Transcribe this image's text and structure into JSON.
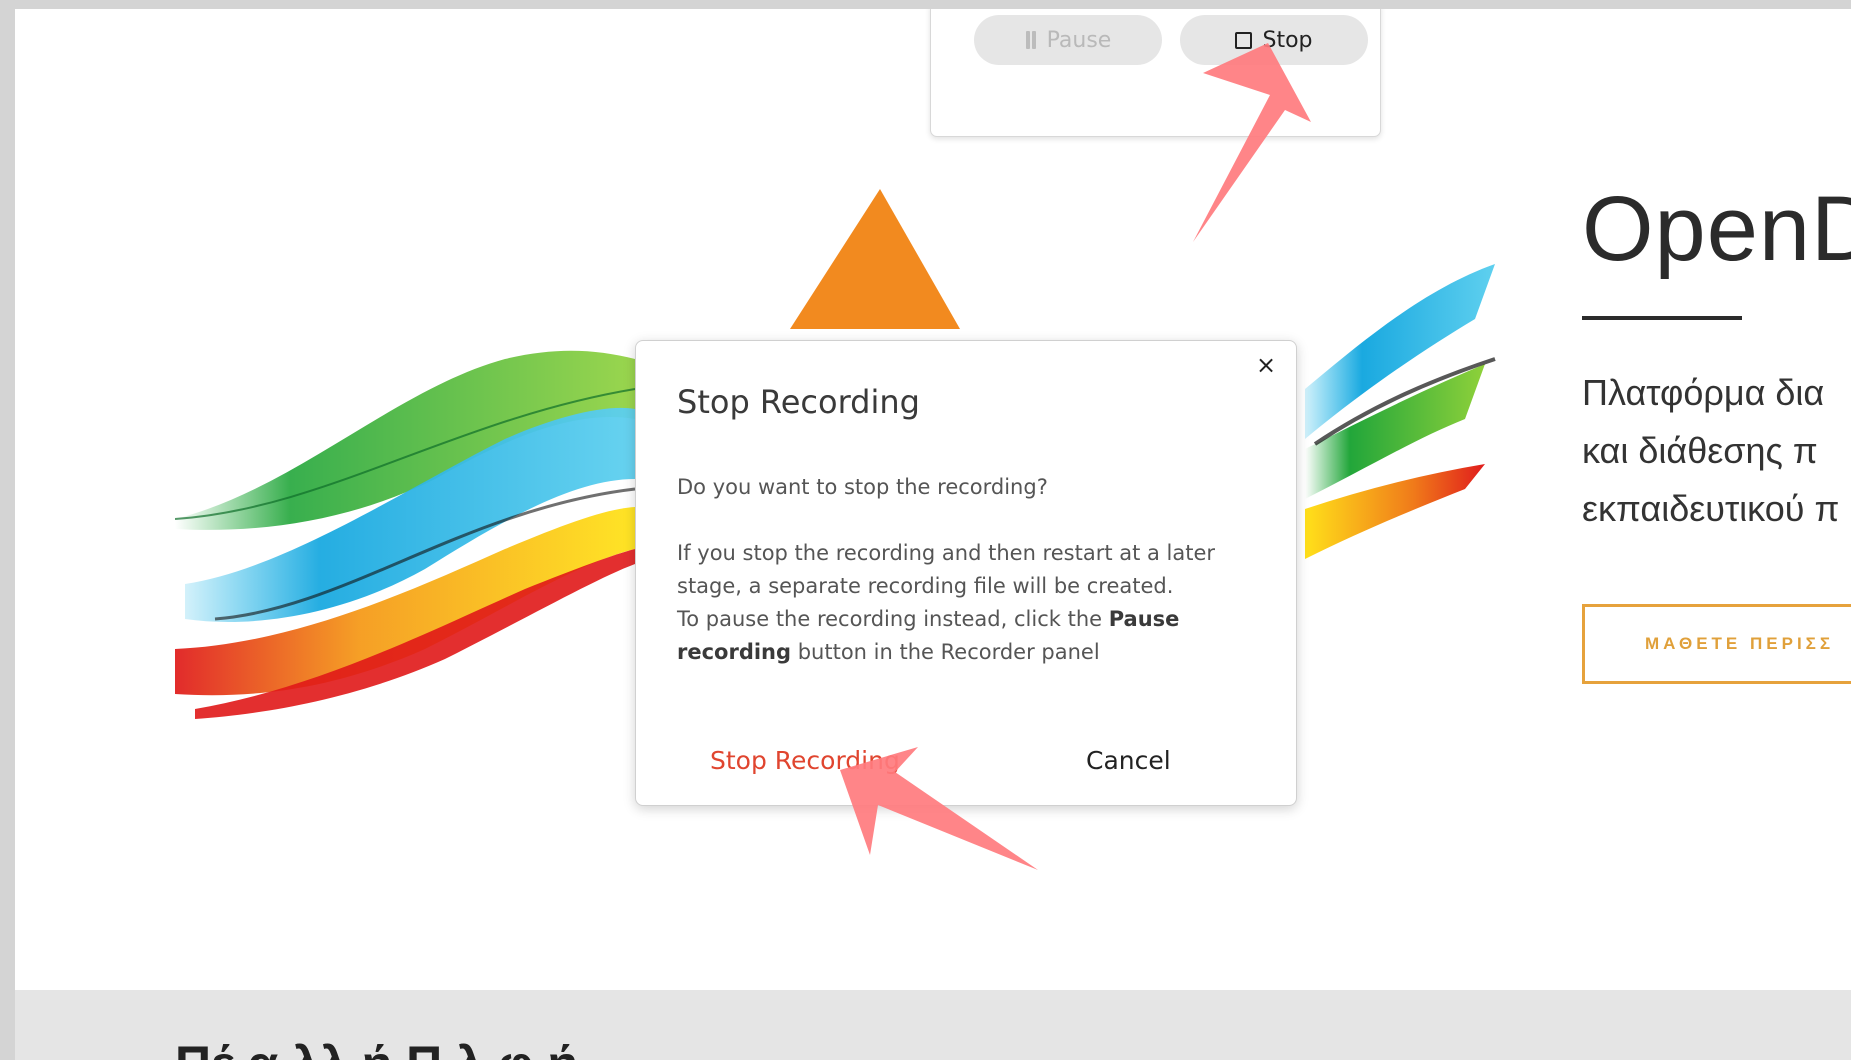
{
  "recorder_panel": {
    "pause_label": "Pause",
    "stop_label": "Stop"
  },
  "hero": {
    "title": "OpenD",
    "description_lines": [
      "Πλατφόρμα δια",
      "και διάθεσης π",
      "εκπαιδευτικού π"
    ],
    "cta_label": "ΜΑΘΕΤΕ ΠΕΡΙΣΣ"
  },
  "dialog": {
    "title": "Stop Recording",
    "close_label": "×",
    "question": "Do you want to stop the recording?",
    "paragraph1": "If you stop the recording and then restart at a later stage, a separate recording file will be created.",
    "paragraph2_prefix": "To pause the recording instead, click the ",
    "paragraph2_bold": "Pause recording",
    "paragraph2_suffix": " button in the Recorder panel",
    "stop_button": "Stop Recording",
    "cancel_button": "Cancel"
  },
  "section": {
    "heading": "Πέ  α λλ  ή  Π              λ         φ      ή"
  },
  "colors": {
    "accent_orange": "#f28a1f",
    "danger_red": "#e0452f",
    "annotation_arrow": "#ff7b7e",
    "cta_border": "#e6a23c"
  },
  "icons": [
    "pause-icon",
    "stop-icon",
    "close-icon",
    "annotation-arrow"
  ]
}
